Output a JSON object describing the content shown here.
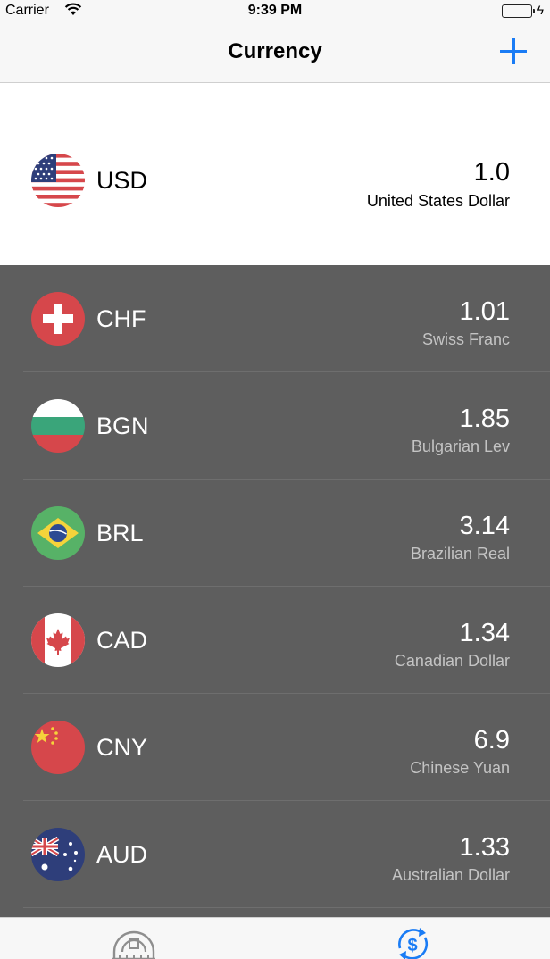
{
  "status_bar": {
    "carrier": "Carrier",
    "time": "9:39 PM",
    "charging_symbol": "ϟ"
  },
  "nav": {
    "title": "Currency",
    "add_icon": "plus-icon"
  },
  "colors": {
    "accent": "#1a7cf5",
    "list_background": "#5e5e5e",
    "battery": "#4cd964"
  },
  "base_currency": {
    "code": "USD",
    "rate": "1.0",
    "name": "United States Dollar",
    "flag": "us-flag-icon"
  },
  "currencies": [
    {
      "code": "CHF",
      "rate": "1.01",
      "name": "Swiss Franc",
      "flag": "swiss-flag-icon"
    },
    {
      "code": "BGN",
      "rate": "1.85",
      "name": "Bulgarian Lev",
      "flag": "bulgaria-flag-icon"
    },
    {
      "code": "BRL",
      "rate": "3.14",
      "name": "Brazilian Real",
      "flag": "brazil-flag-icon"
    },
    {
      "code": "CAD",
      "rate": "1.34",
      "name": "Canadian Dollar",
      "flag": "canada-flag-icon"
    },
    {
      "code": "CNY",
      "rate": "6.9",
      "name": "Chinese Yuan",
      "flag": "china-flag-icon"
    },
    {
      "code": "AUD",
      "rate": "1.33",
      "name": "Australian Dollar",
      "flag": "australia-flag-icon"
    }
  ],
  "tabs": [
    {
      "icon": "ruler-protractor-icon",
      "active": false
    },
    {
      "icon": "currency-exchange-icon",
      "active": true
    }
  ]
}
